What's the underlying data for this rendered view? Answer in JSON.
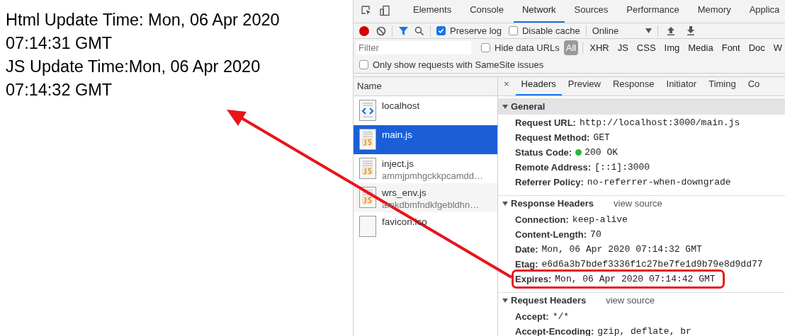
{
  "page": {
    "lines": [
      "Html Update Time: Mon, 06 Apr 2020 07:14:31 GMT",
      "JS Update Time:Mon, 06 Apr 2020 07:14:32 GMT"
    ]
  },
  "devtools": {
    "tabs": [
      {
        "label": "Elements",
        "selected": false
      },
      {
        "label": "Console",
        "selected": false
      },
      {
        "label": "Network",
        "selected": true
      },
      {
        "label": "Sources",
        "selected": false
      },
      {
        "label": "Performance",
        "selected": false
      },
      {
        "label": "Memory",
        "selected": false
      },
      {
        "label": "Applica",
        "selected": false
      }
    ],
    "toolbar": {
      "recording": true,
      "preserve_log": {
        "label": "Preserve log",
        "checked": true
      },
      "disable_cache": {
        "label": "Disable cache",
        "checked": false
      },
      "throttling": "Online"
    },
    "filter": {
      "placeholder": "Filter",
      "hide_data_urls": {
        "label": "Hide data URLs",
        "checked": false
      },
      "types": [
        {
          "label": "All",
          "selected": true
        },
        {
          "label": "XHR",
          "selected": false
        },
        {
          "label": "JS",
          "selected": false
        },
        {
          "label": "CSS",
          "selected": false
        },
        {
          "label": "Img",
          "selected": false
        },
        {
          "label": "Media",
          "selected": false
        },
        {
          "label": "Font",
          "selected": false
        },
        {
          "label": "Doc",
          "selected": false
        },
        {
          "label": "W",
          "selected": false
        }
      ],
      "samesite": {
        "label": "Only show requests with SameSite issues",
        "checked": false
      }
    },
    "requests": {
      "column": "Name",
      "rows": [
        {
          "kind": "html",
          "name": "localhost",
          "selected": false
        },
        {
          "kind": "js",
          "name": "main.js",
          "selected": true
        },
        {
          "kind": "js",
          "name": "inject.js",
          "detail": "ammjpmhgckkpcamdd…",
          "selected": false
        },
        {
          "kind": "js",
          "name": "wrs_env.js",
          "detail": "amkdbmfndkfgebldhn…",
          "selected": false
        },
        {
          "kind": "blank",
          "name": "favicon.ico",
          "selected": false
        }
      ]
    },
    "detail_tabs": {
      "close": "×",
      "tabs": [
        {
          "label": "Headers",
          "selected": true
        },
        {
          "label": "Preview",
          "selected": false
        },
        {
          "label": "Response",
          "selected": false
        },
        {
          "label": "Initiator",
          "selected": false
        },
        {
          "label": "Timing",
          "selected": false
        },
        {
          "label": "Co",
          "selected": false
        }
      ]
    },
    "sections": [
      {
        "title": "General",
        "expanded": true,
        "rows": [
          {
            "key": "Request URL:",
            "value": "http://localhost:3000/main.js"
          },
          {
            "key": "Request Method:",
            "value": "GET"
          },
          {
            "key": "Status Code:",
            "value": "200 OK",
            "color": "#2fb53a"
          },
          {
            "key": "Remote Address:",
            "value": "[::1]:3000"
          },
          {
            "key": "Referrer Policy:",
            "value": "no-referrer-when-downgrade"
          }
        ]
      },
      {
        "title": "Response Headers",
        "link": "view source",
        "expanded": true,
        "rows": [
          {
            "key": "Connection:",
            "value": "keep-alive"
          },
          {
            "key": "Content-Length:",
            "value": "70"
          },
          {
            "key": "Date:",
            "value": "Mon, 06 Apr 2020 07:14:32 GMT"
          },
          {
            "key": "Etag:",
            "value": "e6d6a3b7bdef3336f1c27be7fe1d9b79e8d9dd77"
          },
          {
            "key": "Expires:",
            "value": "Mon, 06 Apr 2020 07:14:42 GMT",
            "highlighted": true
          }
        ]
      },
      {
        "title": "Request Headers",
        "link": "view source",
        "expanded": true,
        "rows": [
          {
            "key": "Accept:",
            "value": "*/*"
          },
          {
            "key": "Accept-Encoding:",
            "value": "gzip, deflate, br"
          }
        ]
      }
    ]
  }
}
